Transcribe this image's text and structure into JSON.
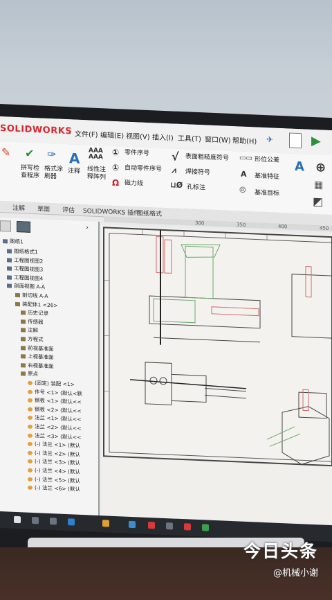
{
  "menubar": {
    "logo": "SOLIDWORKS",
    "items": [
      "文件(F)",
      "编辑(E)",
      "视图(V)",
      "插入(I)",
      "工具(T)",
      "窗口(W)",
      "帮助(H)"
    ]
  },
  "ribbon": {
    "spell_check": "拼写检\n查程序",
    "format_painter": "格式涂\n刷器",
    "note": "注释",
    "linear_pattern": "线性注\n释阵列",
    "balloon": "零件序号",
    "auto_balloon": "自动零件序号",
    "magnetic_line": "磁力线",
    "surface_finish": "表面粗糙度符号",
    "weld_symbol": "焊接符号",
    "hole_callout": "孔标注",
    "geometric_tolerance": "形位公差",
    "datum_feature": "基准特征",
    "datum_target": "基准目标"
  },
  "tabs": [
    "注解",
    "草图",
    "评估",
    "SOLIDWORKS 插件",
    "图纸格式"
  ],
  "ruler": [
    "300",
    "350",
    "400",
    "450"
  ],
  "tree": {
    "root": "图纸1",
    "items": [
      "图纸格式1",
      "工程图视图2",
      "工程图视图3",
      "工程图视图4",
      "剖面视图 A-A",
      "剖切线 A-A",
      "装配体1 <26>",
      "历史记录",
      "传感器",
      "注解",
      "方程式",
      "前视基准面",
      "上视基准面",
      "右视基准面",
      "原点",
      "(固定) 装配 <1>",
      "件号 <1> (默认<默",
      "钢板 <1> (默认<<",
      "钢板 <2> (默认<<",
      "法兰 <1> (默认<<",
      "法兰 <2> (默认<<",
      "法兰 <3> (默认<<",
      "(-) 法兰 <1> (默认",
      "(-) 法兰 <2> (默认",
      "(-) 法兰 <3> (默认",
      "(-) 法兰 <4> (默认",
      "(-) 法兰 <5> (默认",
      "(-) 法兰 <6> (默认"
    ]
  },
  "watermark": {
    "brand": "今日头条",
    "author": "@机械小谢"
  },
  "colors": {
    "logo_red": "#d8282f",
    "screen_bg": "#e9eaec",
    "drawing_bg": "#f0efeb"
  }
}
